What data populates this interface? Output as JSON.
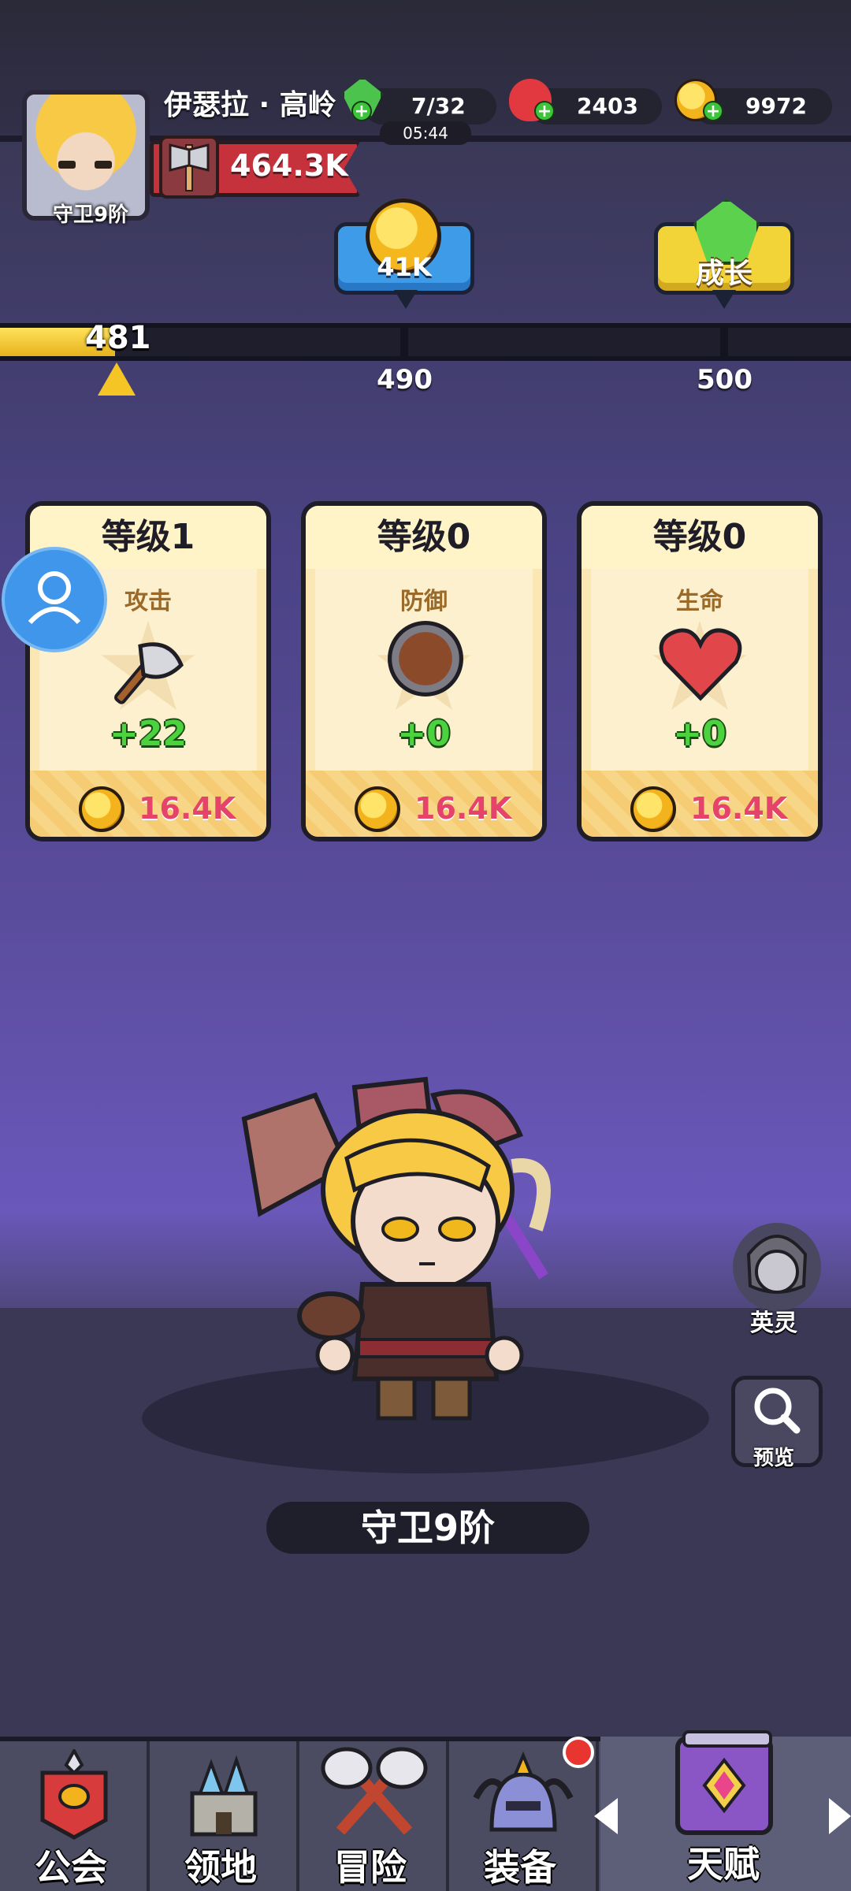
{
  "header": {
    "player_name": "伊瑟拉 · 高岭",
    "rank_label": "守卫9阶",
    "power": "464.3K",
    "energy": "7/32",
    "energy_timer": "05:44",
    "gems": "2403",
    "gold": "9972"
  },
  "rewards": {
    "coin_reward": "41K",
    "growth_label": "成长"
  },
  "progress": {
    "current": "481",
    "marks": [
      "490",
      "500"
    ],
    "fill_fraction": 0.135
  },
  "cards": [
    {
      "level": "等级1",
      "stat": "攻击",
      "bonus": "+22",
      "cost": "16.4K",
      "icon": "axe-icon"
    },
    {
      "level": "等级0",
      "stat": "防御",
      "bonus": "+0",
      "cost": "16.4K",
      "icon": "shield-icon"
    },
    {
      "level": "等级0",
      "stat": "生命",
      "bonus": "+0",
      "cost": "16.4K",
      "icon": "heart-icon"
    }
  ],
  "side_buttons": {
    "spirit": "英灵",
    "preview": "预览"
  },
  "hero": {
    "name": "守卫9阶"
  },
  "nav": {
    "items": [
      "公会",
      "领地",
      "冒险",
      "装备",
      "天赋"
    ]
  },
  "colors": {
    "accent_yellow": "#f2d438",
    "accent_blue": "#3e9be8",
    "bonus_green": "#4bd23e",
    "cost_pink": "#e6436a"
  }
}
